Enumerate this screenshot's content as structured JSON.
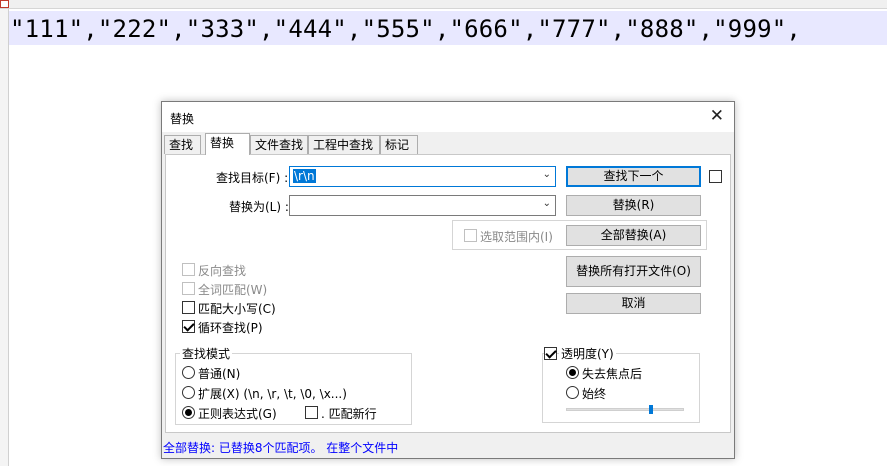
{
  "editor": {
    "line_text": "\"111\",\"222\",\"333\",\"444\",\"555\",\"666\",\"777\",\"888\",\"999\","
  },
  "dialog": {
    "title": "替换",
    "close_glyph": "✕",
    "tabs": [
      {
        "label": "查找"
      },
      {
        "label": "替换"
      },
      {
        "label": "文件查找"
      },
      {
        "label": "工程中查找"
      },
      {
        "label": "标记"
      }
    ],
    "find_label": "查找目标(F) :",
    "find_value": "\\r\\n",
    "replace_label": "替换为(L) :",
    "replace_value": "",
    "buttons": {
      "find_next": "查找下一个",
      "replace": "替换(R)",
      "replace_all": "全部替换(A)",
      "replace_all_open": "替换所有打开文件(O)",
      "cancel": "取消"
    },
    "in_selection": "选取范围内(I)",
    "options": {
      "backward": "反向查找",
      "whole_word": "全词匹配(W)",
      "match_case": "匹配大小写(C)",
      "wrap_around": "循环查找(P)"
    },
    "search_mode": {
      "title": "查找模式",
      "normal": "普通(N)",
      "extended": "扩展(X) (\\n, \\r, \\t, \\0, \\x...)",
      "regex": "正则表达式(G)",
      "dot_newline": ". 匹配新行"
    },
    "transparency": {
      "title": "透明度(Y)",
      "on_lose_focus": "失去焦点后",
      "always": "始终",
      "level": 0.72
    },
    "status": "全部替换: 已替换8个匹配项。 在整个文件中"
  }
}
